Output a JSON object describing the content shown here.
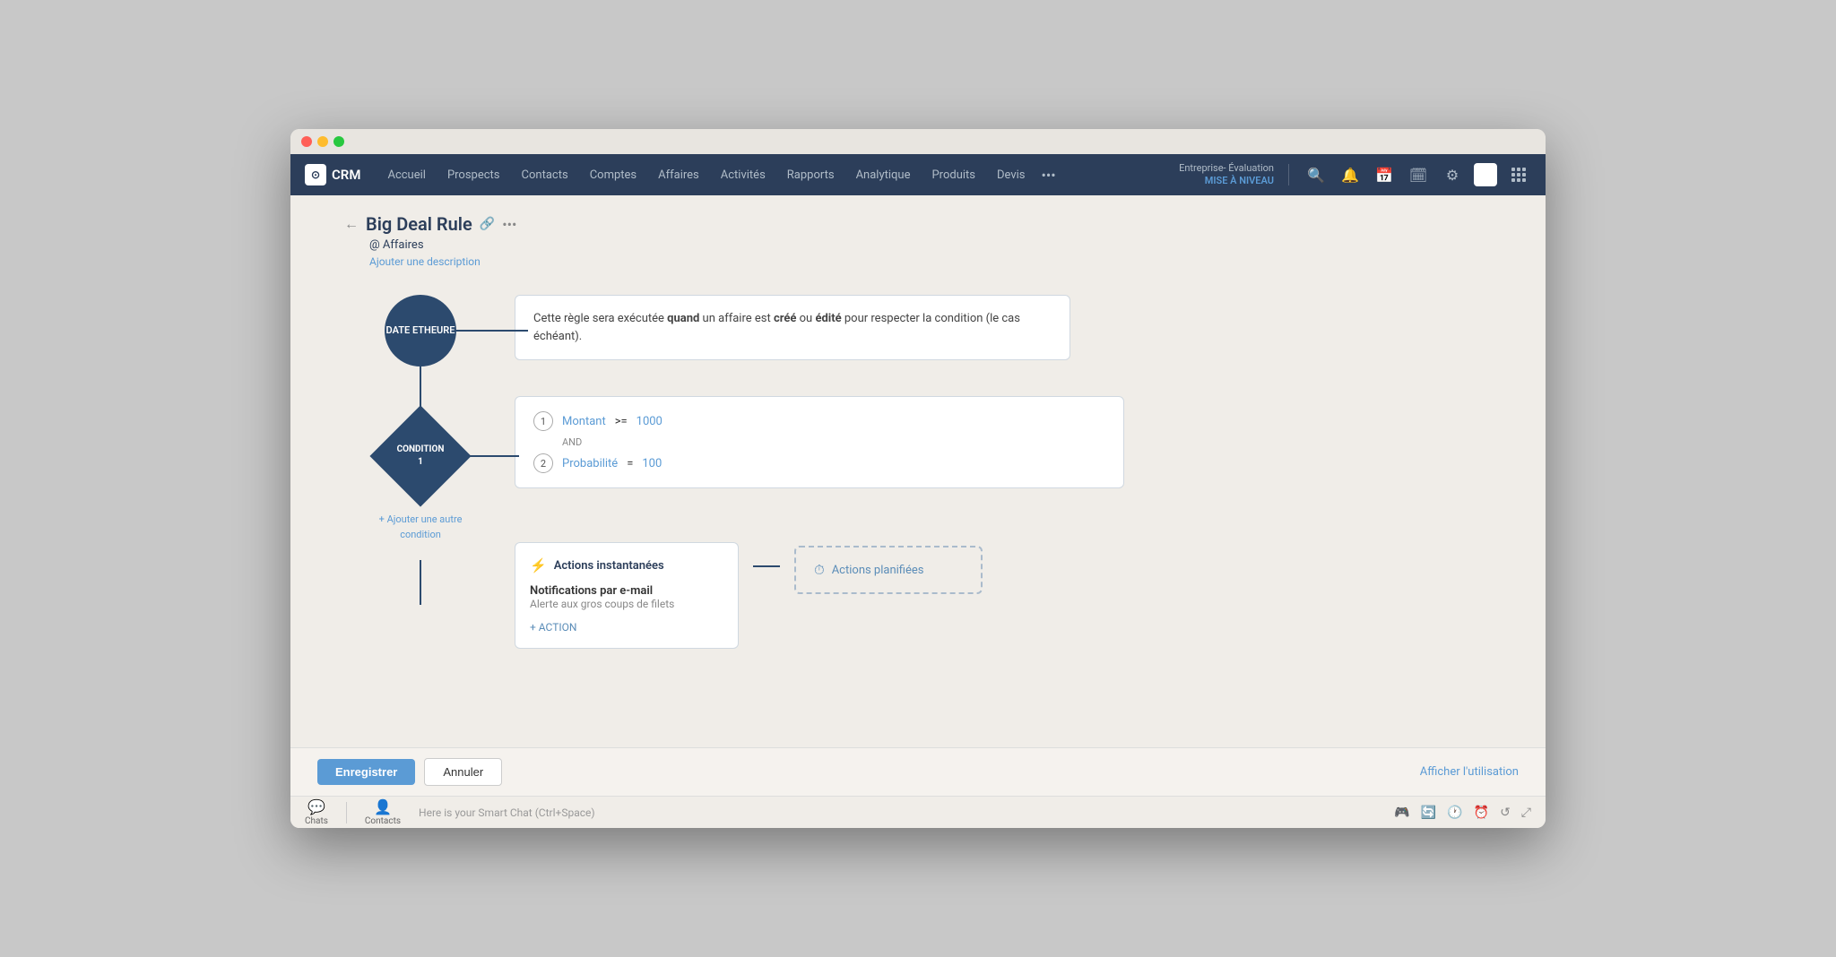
{
  "window": {
    "title": "Big Deal Rule"
  },
  "navbar": {
    "brand": "CRM",
    "items": [
      "Accueil",
      "Prospects",
      "Contacts",
      "Comptes",
      "Affaires",
      "Activités",
      "Rapports",
      "Analytique",
      "Produits",
      "Devis"
    ],
    "more": "•••",
    "enterprise": "Entreprise- Évaluation",
    "upgrade": "MISE À NIVEAU"
  },
  "page": {
    "title": "Big Deal Rule",
    "context": "@ Affaires",
    "add_desc": "Ajouter une description",
    "back_label": "←"
  },
  "trigger_node": {
    "line1": "DATE ET",
    "line2": "HEURE"
  },
  "condition_node": {
    "line1": "CONDITION",
    "line2": "1"
  },
  "info_box": {
    "text_before": "Cette règle sera exécutée ",
    "keyword1": "quand",
    "text_mid1": " un affaire est ",
    "keyword2": "créé",
    "text_mid2": " ou ",
    "keyword3": "édité",
    "text_end": " pour respecter la condition (le cas échéant)."
  },
  "conditions": [
    {
      "number": "1",
      "field": "Montant",
      "operator": ">=",
      "value": "1000"
    },
    {
      "number": "2",
      "field": "Probabilité",
      "operator": "=",
      "value": "100"
    }
  ],
  "conditions_join": "AND",
  "add_condition_label": "+ Ajouter une autre\ncondition",
  "instant_actions": {
    "header": "Actions instantanées",
    "icon": "⚡",
    "item_title": "Notifications par e-mail",
    "item_subtitle": "Alerte aux gros coups de filets",
    "add_label": "+ ACTION"
  },
  "scheduled_actions": {
    "header": "Actions planifiées",
    "icon": "⏱"
  },
  "bottom": {
    "save_label": "Enregistrer",
    "cancel_label": "Annuler",
    "usage_label": "Afficher l'utilisation"
  },
  "smart_chat": {
    "placeholder": "Here is your Smart Chat (Ctrl+Space)",
    "tab1": "Chats",
    "tab2": "Contacts"
  }
}
